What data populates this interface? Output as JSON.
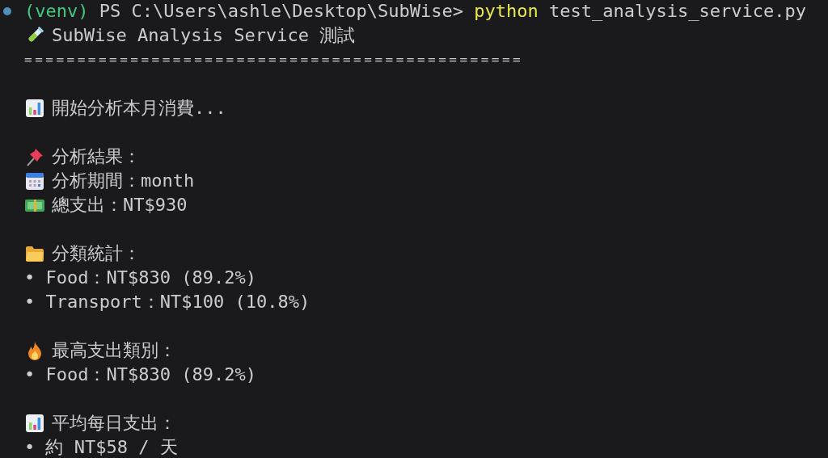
{
  "prompt": {
    "venv": "(venv)",
    "path": "PS C:\\Users\\ashle\\Desktop\\SubWise>",
    "command": "python",
    "args": "test_analysis_service.py"
  },
  "sections": [
    [
      {
        "kind": "test",
        "text": "SubWise Analysis Service 測試"
      },
      {
        "kind": "rule",
        "text": "==============================================="
      }
    ],
    [
      {
        "kind": "chart",
        "text": "開始分析本月消費..."
      }
    ],
    [
      {
        "kind": "pin",
        "text": "分析結果："
      },
      {
        "kind": "calendar",
        "text": "分析期間：month"
      },
      {
        "kind": "money",
        "text": "總支出：NT$930"
      }
    ],
    [
      {
        "kind": "folder",
        "text": "分類統計："
      },
      {
        "kind": "bullet",
        "text": "• Food：NT$830 (89.2%)"
      },
      {
        "kind": "bullet",
        "text": "• Transport：NT$100 (10.8%)"
      }
    ],
    [
      {
        "kind": "fire",
        "text": "最高支出類別："
      },
      {
        "kind": "bullet",
        "text": "• Food：NT$830 (89.2%)"
      }
    ],
    [
      {
        "kind": "chart",
        "text": "平均每日支出："
      },
      {
        "kind": "bullet",
        "text": "• 約 NT$58 / 天"
      }
    ]
  ]
}
